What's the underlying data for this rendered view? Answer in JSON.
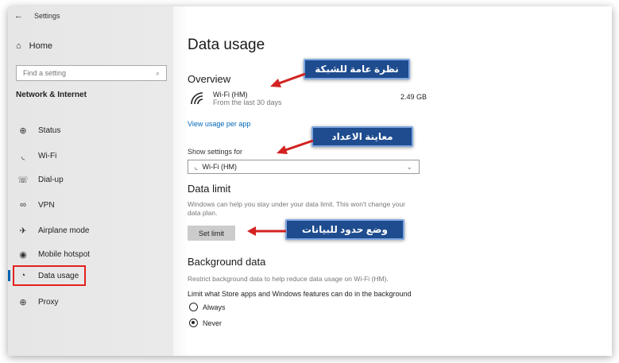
{
  "window": {
    "title": "Settings",
    "back_glyph": "←"
  },
  "sidebar": {
    "home_label": "Home",
    "search_placeholder": "Find a setting",
    "section_title": "Network & Internet",
    "items": [
      {
        "label": "Status",
        "icon": "globe-icon"
      },
      {
        "label": "Wi-Fi",
        "icon": "wifi-icon"
      },
      {
        "label": "Dial-up",
        "icon": "phone-icon"
      },
      {
        "label": "VPN",
        "icon": "vpn-icon"
      },
      {
        "label": "Airplane mode",
        "icon": "airplane-icon"
      },
      {
        "label": "Mobile hotspot",
        "icon": "hotspot-icon"
      },
      {
        "label": "Data usage",
        "icon": "data-usage-icon",
        "selected": true
      },
      {
        "label": "Proxy",
        "icon": "globe-icon"
      }
    ]
  },
  "main": {
    "title": "Data usage",
    "overview": {
      "heading": "Overview",
      "network_name": "Wi-Fi (HM)",
      "period": "From the last 30 days",
      "usage": "2.49 GB",
      "link": "View usage per app"
    },
    "show_settings": {
      "label": "Show settings for",
      "selected": "Wi-Fi (HM)"
    },
    "data_limit": {
      "heading": "Data limit",
      "description": "Windows can help you stay under your data limit. This won't change your data plan.",
      "button": "Set limit"
    },
    "background": {
      "heading": "Background data",
      "description": "Restrict background data to help reduce data usage on Wi-Fi (HM).",
      "question": "Limit what Store apps and Windows features can do in the background",
      "options": [
        "Always",
        "Never"
      ],
      "selected": "Never"
    }
  },
  "annotations": {
    "overview_callout": "نظرة عامة للشبكة",
    "settings_callout": "معاينة الاعداد",
    "limit_callout": "وضع حدود للبيانات"
  },
  "colors": {
    "accent": "#0067b8",
    "highlight": "#e3211f",
    "callout_bg": "#1e4c8e",
    "arrow": "#d42222"
  }
}
